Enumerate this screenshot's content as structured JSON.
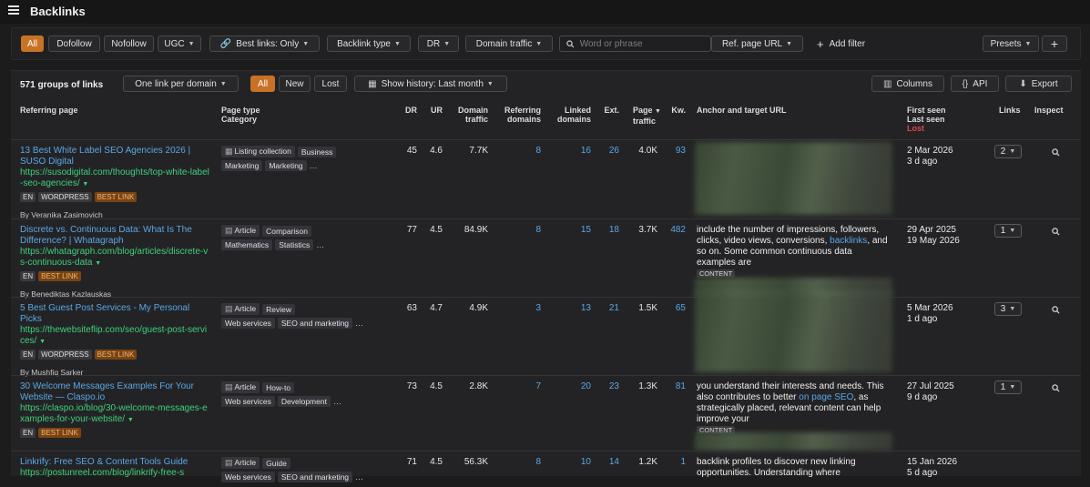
{
  "header": {
    "title": "Backlinks",
    "menu_icon": "hamburger-icon"
  },
  "filters": {
    "type_tabs": [
      "All",
      "Dofollow",
      "Nofollow",
      "UGC"
    ],
    "best_links": "Best links: Only",
    "backlink_type": "Backlink type",
    "dr": "DR",
    "domain_traffic": "Domain traffic",
    "search_placeholder": "Word or phrase",
    "ref_page_url": "Ref. page URL",
    "add_filter": "Add filter",
    "presets": "Presets"
  },
  "toolbar": {
    "groups_count": "571 groups of links",
    "grouping": "One link per domain",
    "status_tabs": [
      "All",
      "New",
      "Lost"
    ],
    "history": "Show history: Last month",
    "columns": "Columns",
    "api": "API",
    "export": "Export"
  },
  "columns": {
    "referring_page": "Referring page",
    "page_type": "Page type",
    "category": "Category",
    "dr": "DR",
    "ur": "UR",
    "domain_traffic_1": "Domain",
    "domain_traffic_2": "traffic",
    "ref_domains_1": "Referring",
    "ref_domains_2": "domains",
    "linked_domains_1": "Linked",
    "linked_domains_2": "domains",
    "ext": "Ext.",
    "page_traffic_1": "Page",
    "page_traffic_2": "traffic",
    "kw": "Kw.",
    "anchor": "Anchor and target URL",
    "first_seen": "First seen",
    "last_seen": "Last seen",
    "lost": "Lost",
    "links": "Links",
    "inspect": "Inspect"
  },
  "rows": [
    {
      "title": "13 Best White Label SEO Agencies 2026 | SUSO Digital",
      "url": "https://susodigital.com/thoughts/top-white-label-seo-agencies/",
      "tags": [
        "EN",
        "WORDPRESS",
        "BEST LINK"
      ],
      "author": "By Veranika Zasimovich",
      "page_type": "Listing collection",
      "cats": [
        "Business",
        "Marketing",
        "Marketing"
      ],
      "dr": "45",
      "ur": "4.6",
      "dtraffic": "7.7K",
      "refdom": "8",
      "linked": "16",
      "ext": "26",
      "ptraffic": "4.0K",
      "kw": "93",
      "anchor": "",
      "first_seen": "2 Mar 2026",
      "last_seen": "3 d ago",
      "links": "2"
    },
    {
      "title": "Discrete vs. Continuous Data: What Is The Difference? | Whatagraph",
      "url": "https://whatagraph.com/blog/articles/discrete-vs-continuous-data",
      "tags": [
        "EN",
        "BEST LINK"
      ],
      "author": "By Benediktas Kazlauskas",
      "page_type": "Article",
      "cats": [
        "Comparison",
        "Mathematics",
        "Statistics"
      ],
      "dr": "77",
      "ur": "4.5",
      "dtraffic": "84.9K",
      "refdom": "8",
      "linked": "15",
      "ext": "18",
      "ptraffic": "3.7K",
      "kw": "482",
      "anchor_pre": "include the number of impressions, followers, clicks, video views, conversions,",
      "anchor_link": "backlinks",
      "anchor_post": ", and so on. Some common continuous data examples are",
      "anchor_tag": "CONTENT",
      "first_seen": "29 Apr 2025",
      "last_seen": "19 May 2026",
      "links": "1"
    },
    {
      "title": "5 Best Guest Post Services - My Personal Picks",
      "url": "https://thewebsiteflip.com/seo/guest-post-services/",
      "tags": [
        "EN",
        "WORDPRESS",
        "BEST LINK"
      ],
      "author": "By Mushfiq Sarker",
      "page_type": "Article",
      "cats": [
        "Review",
        "Web services",
        "SEO and marketing"
      ],
      "dr": "63",
      "ur": "4.7",
      "dtraffic": "4.9K",
      "refdom": "3",
      "linked": "13",
      "ext": "21",
      "ptraffic": "1.5K",
      "kw": "65",
      "first_seen": "5 Mar 2026",
      "last_seen": "1 d ago",
      "links": "3"
    },
    {
      "title": "30 Welcome Messages Examples For Your Website — Claspo.io",
      "url": "https://claspo.io/blog/30-welcome-messages-examples-for-your-website/",
      "tags": [
        "EN",
        "BEST LINK"
      ],
      "page_type": "Article",
      "cats": [
        "How-to",
        "Web services",
        "Development"
      ],
      "dr": "73",
      "ur": "4.5",
      "dtraffic": "2.8K",
      "refdom": "7",
      "linked": "20",
      "ext": "23",
      "ptraffic": "1.3K",
      "kw": "81",
      "anchor_pre": "you understand their interests and needs. This also contributes to better",
      "anchor_link": "on page SEO",
      "anchor_post": ", as strategically placed, relevant content can help improve your",
      "anchor_tag": "CONTENT",
      "first_seen": "27 Jul 2025",
      "last_seen": "9 d ago",
      "links": "1"
    },
    {
      "title": "Linkrify: Free SEO & Content Tools Guide",
      "url": "https://postunreel.com/blog/linkrify-free-s",
      "page_type": "Article",
      "cats": [
        "Guide",
        "Web services",
        "SEO and marketing"
      ],
      "dr": "71",
      "ur": "4.5",
      "dtraffic": "56.3K",
      "refdom": "8",
      "linked": "10",
      "ext": "14",
      "ptraffic": "1.2K",
      "kw": "1",
      "anchor_pre": "backlink profiles to discover new linking opportunities. Understanding where",
      "first_seen": "15 Jan 2026",
      "last_seen": "5 d ago"
    }
  ]
}
